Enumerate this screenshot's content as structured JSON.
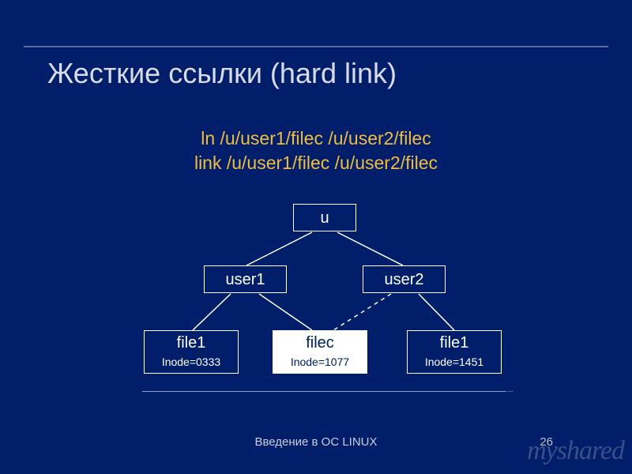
{
  "title": "Жесткие ссылки (hard link)",
  "commands": {
    "line1": "ln /u/user1/filec /u/user2/filec",
    "line2": "link /u/user1/filec /u/user2/filec"
  },
  "tree": {
    "root": "u",
    "left": "user1",
    "right": "user2",
    "leaves": [
      {
        "name": "file1",
        "inode": "Inode=0333"
      },
      {
        "name": "filec",
        "inode": "Inode=1077"
      },
      {
        "name": "file1",
        "inode": "Inode=1451"
      }
    ]
  },
  "footer": "Введение в ОС LINUX",
  "page": "26",
  "watermark": "myshared"
}
